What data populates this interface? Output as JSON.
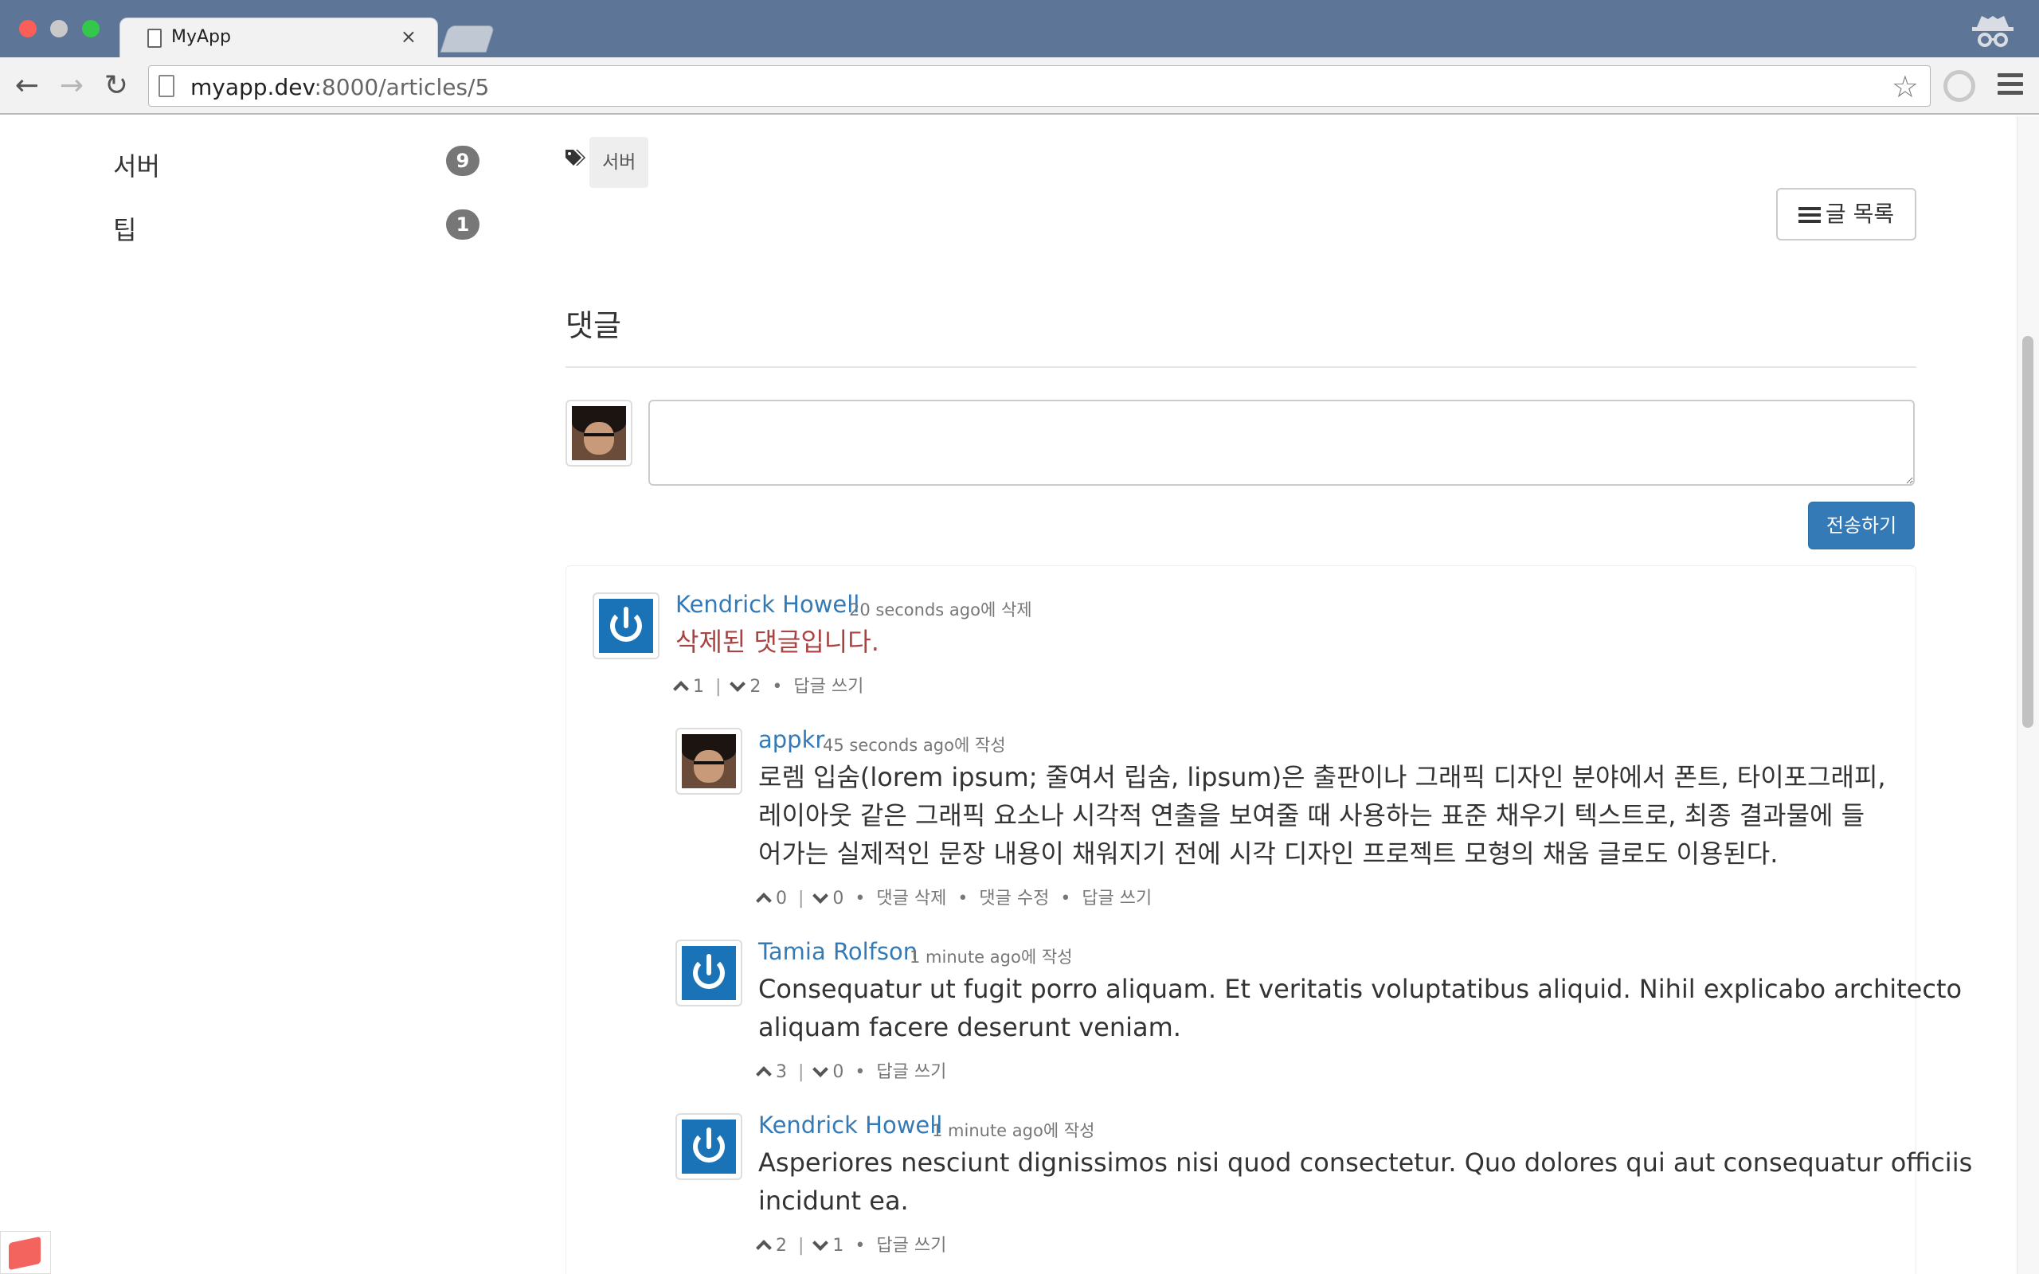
{
  "browser": {
    "tab_title": "MyApp",
    "tab_close": "×",
    "url_host": "myapp.dev",
    "url_rest": ":8000/articles/5",
    "star": "☆",
    "back": "←",
    "forward": "→",
    "reload": "↻"
  },
  "sidebar": {
    "items": [
      {
        "label": "서버",
        "count": "9"
      },
      {
        "label": "팁",
        "count": "1"
      }
    ]
  },
  "article": {
    "tag": "서버",
    "list_button": "글 목록"
  },
  "comments": {
    "title": "댓글",
    "textarea_value": "",
    "submit_label": "전송하기",
    "items": [
      {
        "author": "Kendrick Howell",
        "meta": "20 seconds ago에 삭제",
        "body": "삭제된 댓글입니다.",
        "up": "1",
        "down": "2",
        "actions": [
          "답글 쓰기"
        ]
      },
      {
        "author": "appkr",
        "meta": "45 seconds ago에 작성",
        "body_lines": [
          "로렘 입숨(lorem ipsum; 줄여서 립숨, lipsum)은 출판이나 그래픽 디자인 분야에서 폰트, 타이포그래피,",
          "레이아웃 같은 그래픽 요소나 시각적 연출을 보여줄 때 사용하는 표준 채우기 텍스트로, 최종 결과물에 들",
          "어가는 실제적인 문장 내용이 채워지기 전에 시각 디자인 프로젝트 모형의 채움 글로도 이용된다."
        ],
        "up": "0",
        "down": "0",
        "actions": [
          "댓글 삭제",
          "댓글 수정",
          "답글 쓰기"
        ]
      },
      {
        "author": "Tamia Rolfson",
        "meta": "1 minute ago에 작성",
        "body_lines": [
          "Consequatur ut fugit porro aliquam. Et veritatis voluptatibus aliquid. Nihil explicabo architecto",
          "aliquam facere deserunt veniam."
        ],
        "up": "3",
        "down": "0",
        "actions": [
          "답글 쓰기"
        ]
      },
      {
        "author": "Kendrick Howell",
        "meta": "1 minute ago에 작성",
        "body_lines": [
          "Asperiores nesciunt dignissimos nisi quod consectetur. Quo dolores qui aut consequatur officiis",
          "incidunt ea."
        ],
        "up": "2",
        "down": "1",
        "actions": [
          "답글 쓰기"
        ]
      }
    ]
  },
  "colors": {
    "link": "#337ab7",
    "primary_button": "#337ab7",
    "deleted_text": "#a94442",
    "badge": "#777777",
    "chrome_titlebar": "#5d7596"
  }
}
